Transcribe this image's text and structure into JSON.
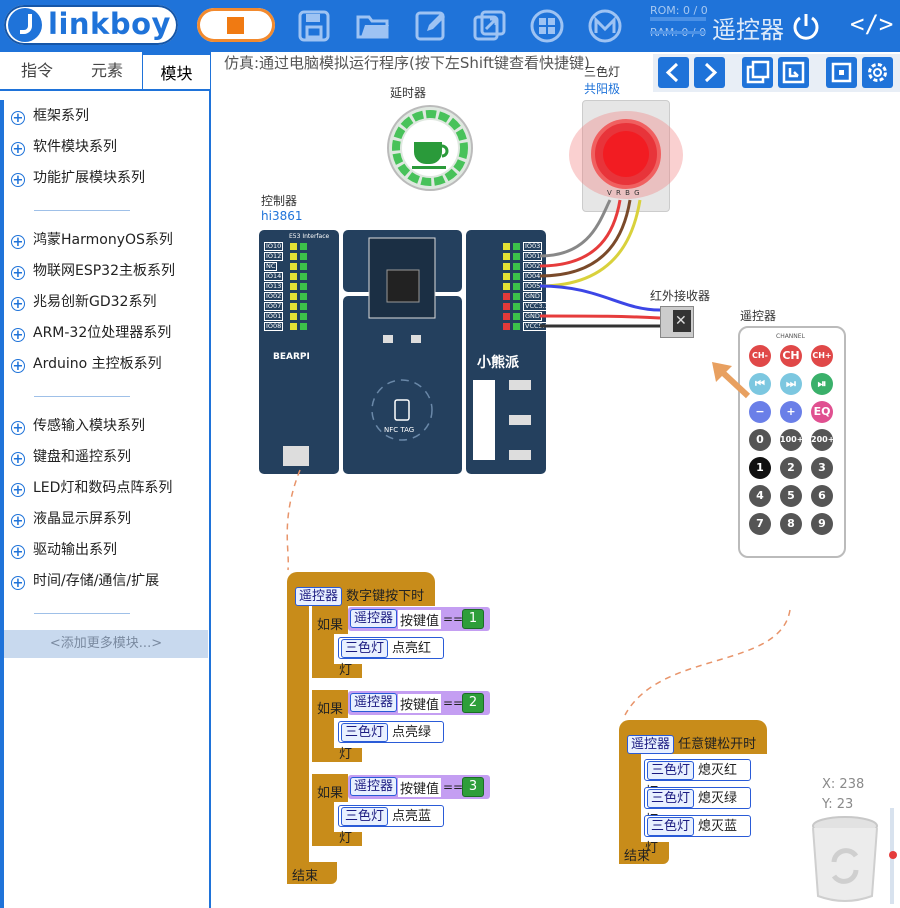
{
  "app": {
    "logo_text": "linkboy"
  },
  "topbar": {
    "rom": "ROM: 0 / 0",
    "ram": "RAM: 0 / 0",
    "mode_label": "遥控器",
    "code_icon": "</>",
    "icons": [
      "save-icon",
      "open-folder-icon",
      "edit-icon",
      "export-icon",
      "grid-icon",
      "m-logo-icon"
    ]
  },
  "tabs": [
    {
      "label": "指令"
    },
    {
      "label": "元素"
    },
    {
      "label": "模块"
    }
  ],
  "categories": {
    "group1": [
      "框架系列",
      "软件模块系列",
      "功能扩展模块系列"
    ],
    "group2": [
      "鸿蒙HarmonyOS系列",
      "物联网ESP32主板系列",
      "兆易创新GD32系列",
      "ARM-32位处理器系列",
      "Arduino 主控板系列"
    ],
    "group3": [
      "传感输入模块系列",
      "键盘和遥控系列",
      "LED灯和数码点阵系列",
      "液晶显示屏系列",
      "驱动输出系列",
      "时间/存储/通信/扩展"
    ],
    "add_more": "<添加更多模块...>"
  },
  "workspace": {
    "title": "仿真:通过电脑模拟运行程序(按下左Shift键查看快捷键)",
    "coords": {
      "x": "X: 238",
      "y": "Y: 23"
    }
  },
  "components": {
    "timer": {
      "label": "延时器"
    },
    "rgb_led": {
      "label": "三色灯",
      "sub": "共阳极",
      "pins": "V R B G"
    },
    "controller": {
      "label": "控制器",
      "sub": "hi3861",
      "brand": "BEARPI",
      "board_title": "小熊派",
      "nfc": "NFC TAG",
      "interface": "E53 Interface"
    },
    "ir_receiver": {
      "label": "红外接收器"
    },
    "remote": {
      "label": "遥控器",
      "channel": "CHANNEL"
    }
  },
  "board": {
    "left_pins": [
      "IO10",
      "IO12",
      "NC",
      "IO14",
      "IO13",
      "IO02",
      "IO07",
      "IO01",
      "IO08"
    ],
    "right_pins": [
      "IO03",
      "IO01",
      "IO02",
      "IO04",
      "IO05",
      "GND",
      "VCC3.3",
      "GND",
      "VCC5.0"
    ]
  },
  "remote_keys": [
    [
      "CH-",
      "CH",
      "CH+"
    ],
    [
      "⏮",
      "⏭",
      "⏯"
    ],
    [
      "−",
      "+",
      "EQ"
    ],
    [
      "0",
      "100+",
      "200+"
    ],
    [
      "1",
      "2",
      "3"
    ],
    [
      "4",
      "5",
      "6"
    ],
    [
      "7",
      "8",
      "9"
    ]
  ],
  "blocks": {
    "event1": {
      "module": "遥控器",
      "event": "数字键按下时"
    },
    "if_label": "如果",
    "key_module": "遥控器",
    "key_value": "按键值",
    "eq": "==",
    "conditions": [
      {
        "value": "1",
        "module": "三色灯",
        "action": "点亮红灯"
      },
      {
        "value": "2",
        "module": "三色灯",
        "action": "点亮绿灯"
      },
      {
        "value": "3",
        "module": "三色灯",
        "action": "点亮蓝灯"
      }
    ],
    "end_label": "结束",
    "event2": {
      "module": "遥控器",
      "event": "任意键松开时"
    },
    "event2_actions": [
      {
        "module": "三色灯",
        "action": "熄灭红灯"
      },
      {
        "module": "三色灯",
        "action": "熄灭绿灯"
      },
      {
        "module": "三色灯",
        "action": "熄灭蓝灯"
      }
    ]
  },
  "colors": {
    "primary": "#1f73d9",
    "block": "#c88c1a",
    "condition": "#c49ef2",
    "number": "#2e9e3a",
    "stop": "#f07a12"
  }
}
